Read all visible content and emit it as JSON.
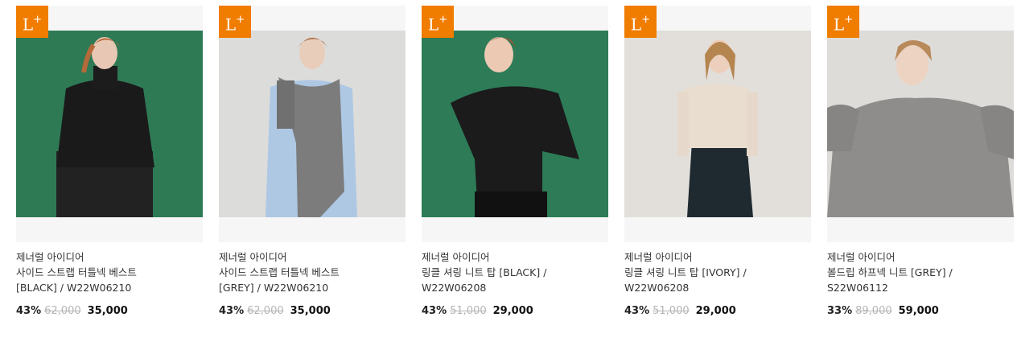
{
  "badge": {
    "main": "L",
    "sup": "+"
  },
  "products": [
    {
      "brand": "제너럴 아이디어",
      "name_line1": "사이드 스트랩 터틀넥 베스트",
      "name_line2": "[BLACK] / W22W06210",
      "discount": "43%",
      "original_price": "62,000",
      "sale_price": "35,000",
      "photo_bg": "#2e7a55",
      "garment": "#1a1a1a"
    },
    {
      "brand": "제너럴 아이디어",
      "name_line1": "사이드 스트랩 터틀넥 베스트",
      "name_line2": "[GREY] / W22W06210",
      "discount": "43%",
      "original_price": "62,000",
      "sale_price": "35,000",
      "photo_bg": "#dcdcda",
      "garment": "#7c7c7c"
    },
    {
      "brand": "제너럴 아이디어",
      "name_line1": "링클 셔링 니트 탑 [BLACK] /",
      "name_line2": "W22W06208",
      "discount": "43%",
      "original_price": "51,000",
      "sale_price": "29,000",
      "photo_bg": "#2d7b57",
      "garment": "#1b1b1b"
    },
    {
      "brand": "제너럴 아이디어",
      "name_line1": "링클 셔링 니트 탑 [IVORY] /",
      "name_line2": "W22W06208",
      "discount": "43%",
      "original_price": "51,000",
      "sale_price": "29,000",
      "photo_bg": "#e2dfdb",
      "garment": "#e9ddd0"
    },
    {
      "brand": "제너럴 아이디어",
      "name_line1": "볼드립 하프넥 니트 [GREY] /",
      "name_line2": "S22W06112",
      "discount": "33%",
      "original_price": "89,000",
      "sale_price": "59,000",
      "photo_bg": "#dedcd8",
      "garment": "#8f8d8b"
    }
  ]
}
